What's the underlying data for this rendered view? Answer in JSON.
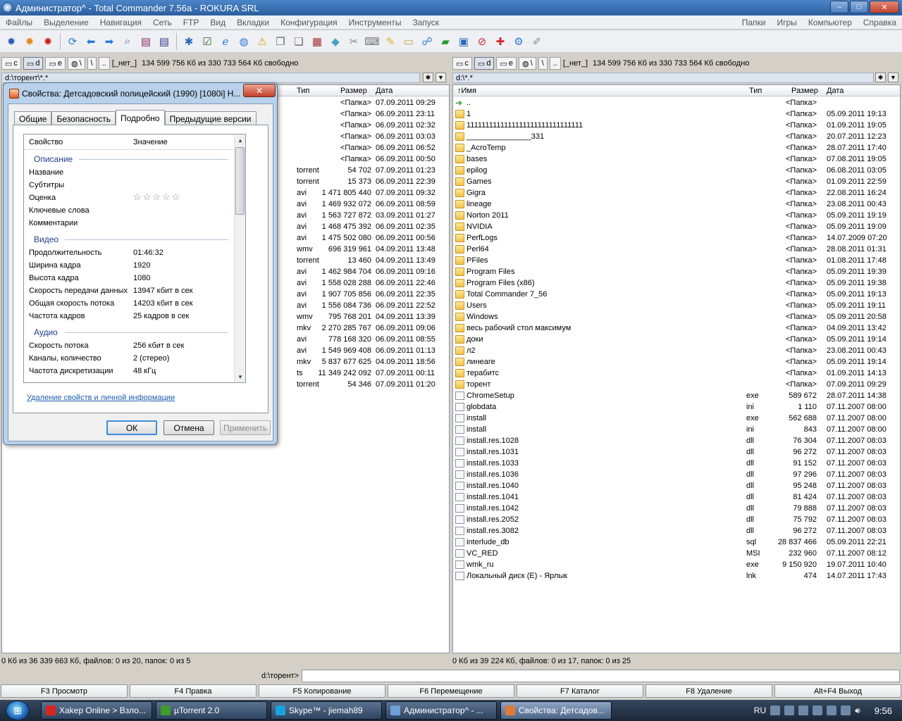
{
  "window": {
    "title": "Администратор^ - Total Commander 7.56a - ROKURA SRL",
    "min": "–",
    "max": "□",
    "close": "✕"
  },
  "menu": {
    "left": [
      "Файлы",
      "Выделение",
      "Навигация",
      "Сеть",
      "FTP",
      "Вид",
      "Вкладки",
      "Конфигурация",
      "Инструменты",
      "Запуск"
    ],
    "right": [
      "Папки",
      "Игры",
      "Компьютер",
      "Справка"
    ]
  },
  "toolbar_icons": [
    "gear-icon",
    "gear-icon",
    "gear-icon",
    "refresh-icon",
    "arrow-left-icon",
    "arrow-right-icon",
    "search-icon",
    "archive-icon",
    "archive-icon",
    "tool-icon",
    "checklist-icon",
    "ie-icon",
    "globe-icon",
    "warning-icon",
    "file-icon",
    "file-icon",
    "grid-icon",
    "eraser-icon",
    "scissors-icon",
    "keyboard-icon",
    "note-icon",
    "page-icon",
    "network-icon",
    "money-icon",
    "image-icon",
    "block-icon",
    "plus-icon",
    "tools-icon",
    "brush-icon"
  ],
  "drives": {
    "c": "c",
    "d": "d",
    "e": "e",
    "net": "\\",
    "root": "\\",
    "up": "..",
    "netlabel": "[_нет_]",
    "free": "134 599 756 Кб из 330 733 564 Кб свободно"
  },
  "left": {
    "path": "d:\\торент\\*.*",
    "headers": {
      "type": "Тип",
      "size": "Размер",
      "date": "Дата"
    },
    "rows": [
      {
        "type": "",
        "size": "<Папка>",
        "date": "07.09.2011 09:29"
      },
      {
        "type": "",
        "size": "<Папка>",
        "date": "06.09.2011 23:11"
      },
      {
        "type": "",
        "size": "<Папка>",
        "date": "06.09.2011 02:32"
      },
      {
        "type": "",
        "size": "<Папка>",
        "date": "06.09.2011 03:03"
      },
      {
        "type": "",
        "size": "<Папка>",
        "date": "06.09.2011 06:52"
      },
      {
        "type": "",
        "size": "<Папка>",
        "date": "06.09.2011 00:50"
      },
      {
        "type": "torrent",
        "size": "54 702",
        "date": "07.09.2011 01:23"
      },
      {
        "type": "torrent",
        "size": "15 373",
        "date": "06.09.2011 22:39"
      },
      {
        "type": "avi",
        "size": "1 471 805 440",
        "date": "07.09.2011 09:32"
      },
      {
        "type": "avi",
        "size": "1 469 932 072",
        "date": "06.09.2011 08:59"
      },
      {
        "type": "avi",
        "size": "1 563 727 872",
        "date": "03.09.2011 01:27"
      },
      {
        "type": "avi",
        "size": "1 468 475 392",
        "date": "06.09.2011 02:35"
      },
      {
        "type": "avi",
        "size": "1 475 502 080",
        "date": "06.09.2011 00:56"
      },
      {
        "type": "wmv",
        "size": "696 319 961",
        "date": "04.09.2011 13:48"
      },
      {
        "type": "torrent",
        "size": "13 460",
        "date": "04.09.2011 13:49"
      },
      {
        "type": "avi",
        "size": "1 462 984 704",
        "date": "06.09.2011 09:16"
      },
      {
        "type": "avi",
        "size": "1 558 028 288",
        "date": "06.09.2011 22:46"
      },
      {
        "type": "avi",
        "size": "1 907 705 856",
        "date": "06.09.2011 22:35"
      },
      {
        "type": "avi",
        "size": "1 556 084 736",
        "date": "06.09.2011 22:52"
      },
      {
        "type": "wmv",
        "size": "795 768 201",
        "date": "04.09.2011 13:39"
      },
      {
        "type": "mkv",
        "size": "2 270 285 767",
        "date": "06.09.2011 09:06"
      },
      {
        "type": "avi",
        "size": "778 168 320",
        "date": "06.09.2011 08:55"
      },
      {
        "type": "avi",
        "size": "1 549 969 408",
        "date": "06.09.2011 01:13"
      },
      {
        "type": "mkv",
        "size": "5 837 677 625",
        "date": "04.09.2011 18:56"
      },
      {
        "type": "ts",
        "size": "11 349 242 092",
        "date": "07.09.2011 00:11"
      },
      {
        "type": "torrent",
        "size": "54 346",
        "date": "07.09.2011 01:20"
      }
    ],
    "status": "0 Кб из 36 339 663 Кб, файлов: 0 из 20, папок: 0 из 5"
  },
  "right": {
    "path": "d:\\*.*",
    "headers": {
      "name": "↑Имя",
      "type": "Тип",
      "size": "Размер",
      "date": "Дата"
    },
    "rows": [
      {
        "name": "..",
        "type": "",
        "size": "<Папка>",
        "date": "",
        "icon": "updir"
      },
      {
        "name": "1",
        "type": "",
        "size": "<Папка>",
        "date": "05.09.2011 19:13",
        "icon": "folder"
      },
      {
        "name": "1111111111111111111111111111111",
        "type": "",
        "size": "<Папка>",
        "date": "01.09.2011 19:05",
        "icon": "folder"
      },
      {
        "name": "_______________331",
        "type": "",
        "size": "<Папка>",
        "date": "20.07.2011 12:23",
        "icon": "folder"
      },
      {
        "name": "_AcroTemp",
        "type": "",
        "size": "<Папка>",
        "date": "28.07.2011 17:40",
        "icon": "folder"
      },
      {
        "name": "bases",
        "type": "",
        "size": "<Папка>",
        "date": "07.08.2011 19:05",
        "icon": "folder"
      },
      {
        "name": "epilog",
        "type": "",
        "size": "<Папка>",
        "date": "06.08.2011 03:05",
        "icon": "folder"
      },
      {
        "name": "Games",
        "type": "",
        "size": "<Папка>",
        "date": "01.09.2011 22:59",
        "icon": "folder"
      },
      {
        "name": "Gigra",
        "type": "",
        "size": "<Папка>",
        "date": "22.08.2011 16:24",
        "icon": "folder"
      },
      {
        "name": "lineage",
        "type": "",
        "size": "<Папка>",
        "date": "23.08.2011 00:43",
        "icon": "folder"
      },
      {
        "name": "Norton 2011",
        "type": "",
        "size": "<Папка>",
        "date": "05.09.2011 19:19",
        "icon": "folder"
      },
      {
        "name": "NVIDIA",
        "type": "",
        "size": "<Папка>",
        "date": "05.09.2011 19:09",
        "icon": "folder"
      },
      {
        "name": "PerfLogs",
        "type": "",
        "size": "<Папка>",
        "date": "14.07.2009 07:20",
        "icon": "folder"
      },
      {
        "name": "Perl64",
        "type": "",
        "size": "<Папка>",
        "date": "28.08.2011 01:31",
        "icon": "folder"
      },
      {
        "name": "PFiles",
        "type": "",
        "size": "<Папка>",
        "date": "01.08.2011 17:48",
        "icon": "folder"
      },
      {
        "name": "Program Files",
        "type": "",
        "size": "<Папка>",
        "date": "05.09.2011 19:39",
        "icon": "folder"
      },
      {
        "name": "Program Files (x86)",
        "type": "",
        "size": "<Папка>",
        "date": "05.09.2011 19:38",
        "icon": "folder"
      },
      {
        "name": "Total Commander 7_56",
        "type": "",
        "size": "<Папка>",
        "date": "05.09.2011 19:13",
        "icon": "folder"
      },
      {
        "name": "Users",
        "type": "",
        "size": "<Папка>",
        "date": "05.09.2011 19:11",
        "icon": "folder"
      },
      {
        "name": "Windows",
        "type": "",
        "size": "<Папка>",
        "date": "05.09.2011 20:58",
        "icon": "folder"
      },
      {
        "name": "весь рабочий стол максимум",
        "type": "",
        "size": "<Папка>",
        "date": "04.09.2011 13:42",
        "icon": "folder"
      },
      {
        "name": "доки",
        "type": "",
        "size": "<Папка>",
        "date": "05.09.2011 19:14",
        "icon": "folder"
      },
      {
        "name": "л2",
        "type": "",
        "size": "<Папка>",
        "date": "23.08.2011 00:43",
        "icon": "folder"
      },
      {
        "name": "линеаге",
        "type": "",
        "size": "<Папка>",
        "date": "05.09.2011 19:14",
        "icon": "folder"
      },
      {
        "name": "терабитс",
        "type": "",
        "size": "<Папка>",
        "date": "01.09.2011 14:13",
        "icon": "folder"
      },
      {
        "name": "торент",
        "type": "",
        "size": "<Папка>",
        "date": "07.09.2011 09:29",
        "icon": "folder"
      },
      {
        "name": "ChromeSetup",
        "type": "exe",
        "size": "589 672",
        "date": "28.07.2011 14:38",
        "icon": "file"
      },
      {
        "name": "globdata",
        "type": "ini",
        "size": "1 110",
        "date": "07.11.2007 08:00",
        "icon": "file"
      },
      {
        "name": "install",
        "type": "exe",
        "size": "562 688",
        "date": "07.11.2007 08:00",
        "icon": "file"
      },
      {
        "name": "install",
        "type": "ini",
        "size": "843",
        "date": "07.11.2007 08:00",
        "icon": "file"
      },
      {
        "name": "install.res.1028",
        "type": "dll",
        "size": "76 304",
        "date": "07.11.2007 08:03",
        "icon": "file"
      },
      {
        "name": "install.res.1031",
        "type": "dll",
        "size": "96 272",
        "date": "07.11.2007 08:03",
        "icon": "file"
      },
      {
        "name": "install.res.1033",
        "type": "dll",
        "size": "91 152",
        "date": "07.11.2007 08:03",
        "icon": "file"
      },
      {
        "name": "install.res.1036",
        "type": "dll",
        "size": "97 296",
        "date": "07.11.2007 08:03",
        "icon": "file"
      },
      {
        "name": "install.res.1040",
        "type": "dll",
        "size": "95 248",
        "date": "07.11.2007 08:03",
        "icon": "file"
      },
      {
        "name": "install.res.1041",
        "type": "dll",
        "size": "81 424",
        "date": "07.11.2007 08:03",
        "icon": "file"
      },
      {
        "name": "install.res.1042",
        "type": "dll",
        "size": "79 888",
        "date": "07.11.2007 08:03",
        "icon": "file"
      },
      {
        "name": "install.res.2052",
        "type": "dll",
        "size": "75 792",
        "date": "07.11.2007 08:03",
        "icon": "file"
      },
      {
        "name": "install.res.3082",
        "type": "dll",
        "size": "96 272",
        "date": "07.11.2007 08:03",
        "icon": "file"
      },
      {
        "name": "interlude_db",
        "type": "sql",
        "size": "28 837 466",
        "date": "05.09.2011 22:21",
        "icon": "file"
      },
      {
        "name": "VC_RED",
        "type": "MSI",
        "size": "232 960",
        "date": "07.11.2007 08:12",
        "icon": "file"
      },
      {
        "name": "wmk_ru",
        "type": "exe",
        "size": "9 150 920",
        "date": "19.07.2011 10:40",
        "icon": "file"
      },
      {
        "name": "Локальный диск (E) - Ярлык",
        "type": "lnk",
        "size": "474",
        "date": "14.07.2011 17:43",
        "icon": "file"
      }
    ],
    "status": "0 Кб из 39 224 Кб, файлов: 0 из 17, папок: 0 из 25"
  },
  "cmdline": {
    "label": "d:\\торент>"
  },
  "fkeys": [
    "F3 Просмотр",
    "F4 Правка",
    "F5 Копирование",
    "F6 Перемещение",
    "F7 Каталог",
    "F8 Удаление",
    "Alt+F4 Выход"
  ],
  "dialog": {
    "title": "Свойства: Детсадовский полицейский (1990) [1080i] H...",
    "close": "✕",
    "tabs": [
      "Общие",
      "Безопасность",
      "Подробно",
      "Предыдущие версии"
    ],
    "col_prop": "Свойство",
    "col_val": "Значение",
    "groups": {
      "desc": "Описание",
      "video": "Видео",
      "audio": "Аудио"
    },
    "desc": [
      "Название",
      "Субтитры",
      "Оценка",
      "Ключевые слова",
      "Комментарии"
    ],
    "rating": "☆☆☆☆☆",
    "video": [
      {
        "p": "Продолжительность",
        "v": "01:46:32"
      },
      {
        "p": "Ширина кадра",
        "v": "1920"
      },
      {
        "p": "Высота кадра",
        "v": "1080"
      },
      {
        "p": "Скорость передачи данных",
        "v": "13947 кбит в сек"
      },
      {
        "p": "Общая скорость потока",
        "v": "14203 кбит в сек"
      },
      {
        "p": "Частота кадров",
        "v": "25 кадров в сек"
      }
    ],
    "audio": [
      {
        "p": "Скорость потока",
        "v": "256 кбит в сек"
      },
      {
        "p": "Каналы, количество",
        "v": "2 (стерео)"
      },
      {
        "p": "Частота дискретизации",
        "v": "48 кГц"
      }
    ],
    "link": "Удаление свойств и личной информации",
    "ok": "ОК",
    "cancel": "Отмена",
    "apply": "Применить"
  },
  "taskbar": {
    "start": "⊞",
    "tasks": [
      {
        "label": "Xakep Online > Взло...",
        "color": "#d8261e"
      },
      {
        "label": "µTorrent 2.0",
        "color": "#3e9a2e"
      },
      {
        "label": "Skype™ - jiemah89",
        "color": "#18a3e0"
      },
      {
        "label": "Администратор^ - ...",
        "color": "#6f9fd8"
      },
      {
        "label": "Свойства: Детсадов...",
        "color": "#e07a3a"
      }
    ],
    "lang": "RU",
    "clock": "9:56"
  }
}
